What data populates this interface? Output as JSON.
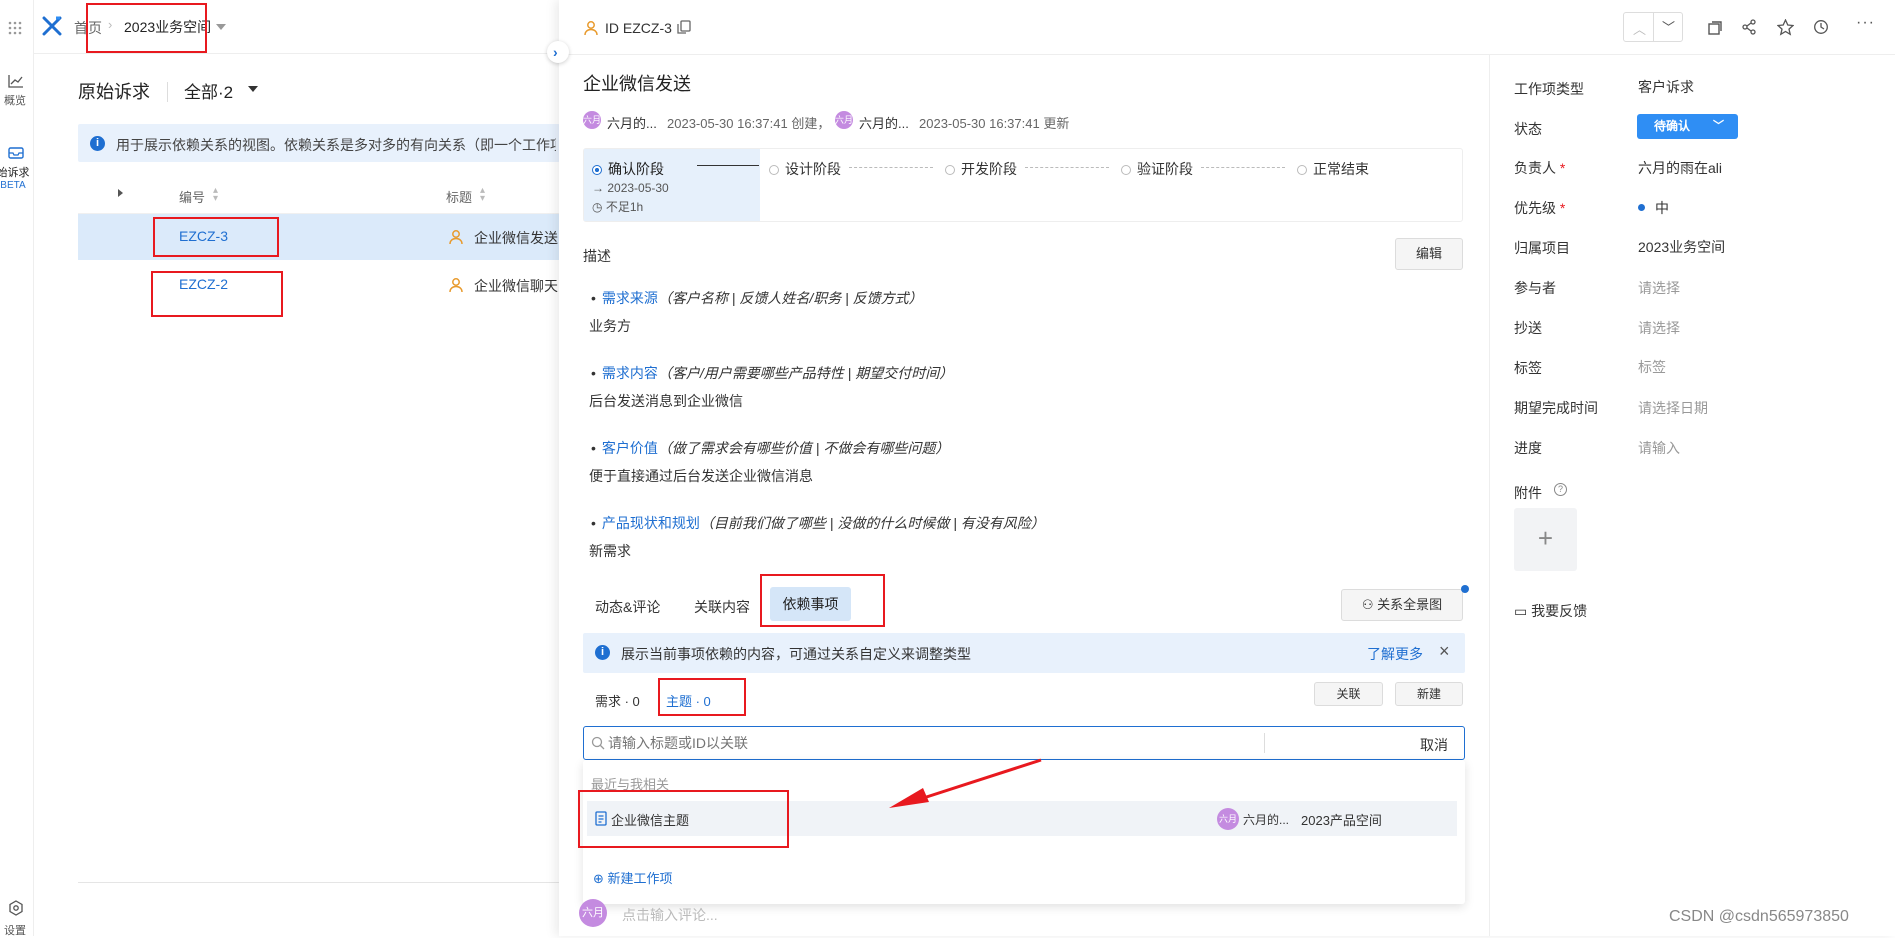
{
  "nav": {
    "home": "首页",
    "space": "2023业务空间"
  },
  "rail": {
    "overview": "概览",
    "requests": "始诉求",
    "beta": "BETA",
    "settings": "设置"
  },
  "list": {
    "title": "原始诉求",
    "filter": "全部·2",
    "info": "用于展示依赖关系的视图。依赖关系是多对多的有向关系（即一个工作项",
    "col_id": "编号",
    "col_title": "标题",
    "rows": [
      {
        "id": "EZCZ-3",
        "title": "企业微信发送"
      },
      {
        "id": "EZCZ-2",
        "title": "企业微信聊天"
      }
    ]
  },
  "item": {
    "id_label": "ID EZCZ-3",
    "title": "企业微信发送",
    "creator": "六月的...",
    "created": "2023-05-30 16:37:41 创建，",
    "updater": "六月的...",
    "updated": "2023-05-30 16:37:41 更新",
    "avatar_text": "六月"
  },
  "stages": {
    "s1": "确认阶段",
    "s1_date": "2023-05-30",
    "s1_time": "不足1h",
    "s2": "设计阶段",
    "s3": "开发阶段",
    "s4": "验证阶段",
    "s5": "正常结束"
  },
  "desc": {
    "label": "描述",
    "edit": "编辑",
    "items": [
      {
        "head": "需求来源",
        "hint": "（客户名称 | 反馈人姓名/职务 | 反馈方式）",
        "body": "业务方"
      },
      {
        "head": "需求内容",
        "hint": "（客户/用户需要哪些产品特性 | 期望交付时间）",
        "body": "后台发送消息到企业微信"
      },
      {
        "head": "客户价值",
        "hint": "（做了需求会有哪些价值 | 不做会有哪些问题）",
        "body": "便于直接通过后台发送企业微信消息"
      },
      {
        "head": "产品现状和规划",
        "hint": "（目前我们做了哪些 | 没做的什么时候做 | 有没有风险）",
        "body": "新需求"
      }
    ]
  },
  "tabs": {
    "activity": "动态&评论",
    "related": "关联内容",
    "deps": "依赖事项",
    "graph": "关系全景图"
  },
  "deps": {
    "info": "展示当前事项依赖的内容，可通过关系自定义来调整类型",
    "learn_more": "了解更多",
    "sub_req": "需求 · 0",
    "sub_topic": "主题 · 0",
    "link_btn": "关联",
    "new_btn": "新建",
    "search_placeholder": "请输入标题或ID以关联",
    "cancel": "取消",
    "recent_label": "最近与我相关",
    "result_title": "企业微信主题",
    "result_owner": "六月的...",
    "result_space": "2023产品空间",
    "new_item": "新建工作项"
  },
  "comment": {
    "placeholder": "点击输入评论..."
  },
  "props": {
    "type_label": "工作项类型",
    "type_val": "客户诉求",
    "status_label": "状态",
    "status_val": "待确认",
    "owner_label": "负责人",
    "owner_val": "六月的雨在ali",
    "priority_label": "优先级",
    "priority_val": "中",
    "project_label": "归属项目",
    "project_val": "2023业务空间",
    "participants_label": "参与者",
    "participants_val": "请选择",
    "cc_label": "抄送",
    "cc_val": "请选择",
    "tags_label": "标签",
    "tags_val": "标签",
    "due_label": "期望完成时间",
    "due_val": "请选择日期",
    "progress_label": "进度",
    "progress_val": "请输入",
    "attach_label": "附件",
    "feedback": "我要反馈",
    "required_mark": "*"
  },
  "watermark": "CSDN @csdn565973850",
  "colors": {
    "accent": "#1f6fd1",
    "status": "#2f8ef4",
    "highlight": "#e8191f"
  }
}
